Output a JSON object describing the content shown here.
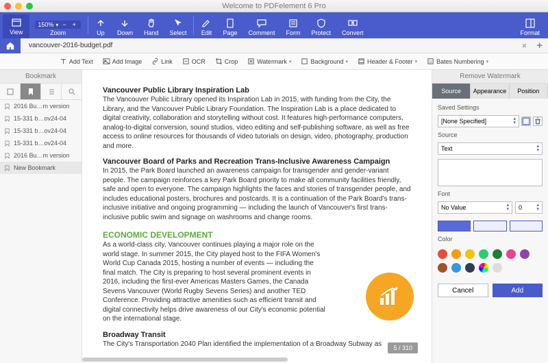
{
  "window": {
    "title": "Welcome to PDFelement 6 Pro"
  },
  "ribbon": {
    "view": "View",
    "zoom": "Zoom",
    "zoom_value": "150%",
    "up": "Up",
    "down": "Down",
    "hand": "Hand",
    "select": "Select",
    "edit": "Edit",
    "page": "Page",
    "comment": "Comment",
    "form": "Form",
    "protect": "Protect",
    "convert": "Convert",
    "format": "Format"
  },
  "tab": {
    "filename": "vancouver-2016-budget.pdf"
  },
  "toolbar2": {
    "add_text": "Add Text",
    "add_image": "Add Image",
    "link": "Link",
    "ocr": "OCR",
    "crop": "Crop",
    "watermark": "Watermark",
    "background": "Background",
    "header_footer": "Header & Footer",
    "bates": "Bates Numbering"
  },
  "sidebar": {
    "title": "Bookmark",
    "items": [
      "2016 Bu…m version",
      "15-331 b…ov24-04",
      "15-331 b…ov24-04",
      "15-331 b…ov24-04",
      "2016 Bu…m version",
      "New Bookmark"
    ]
  },
  "doc": {
    "h1": "Vancouver Public Library Inspiration Lab",
    "p1": "The Vancouver Public Library opened its Inspiration Lab in 2015, with funding from the City, the Library, and the Vancouver Public Library Foundation. The Inspiration Lab is a place dedicated to digital creativity, collaboration and storytelling without cost. It features high-performance computers, analog-to-digital conversion, sound studios, video editing and self-publishing software, as well as free access to online resources for thousands of video tutorials on design, video, photography, production and more.",
    "h2": "Vancouver Board of Parks and Recreation Trans-Inclusive Awareness Campaign",
    "p2": "In 2015, the Park Board launched an awareness campaign for transgender and gender-variant people. The campaign reinforces a key Park Board priority to make all community facilities friendly, safe and open to everyone. The campaign highlights the faces and stories of transgender people, and includes educational posters, brochures and postcards. It is a continuation of the Park Board's trans-inclusive initiative and ongoing programming — including the launch of Vancouver's first trans-inclusive public swim and signage on washrooms and change rooms.",
    "h3": "ECONOMIC DEVELOPMENT",
    "p3": "As a world-class city, Vancouver continues playing a major role on the world stage. In summer 2015, the City played host to the FIFA Women's World Cup Canada 2015, hosting a number of events — including the final match. The City is preparing to host several prominent events in 2016, including the first-ever Americas Masters Games, the Canada Sevens Vancouver (World Rugby Sevens Series) and another TED Conference. Providing attractive amenities such as efficient transit and digital connectivity helps drive awareness of our City's economic potential on the international stage.",
    "h4": "Broadway Transit",
    "p4": "The City's Transportation 2040 Plan identified the implementation of a Broadway Subway as",
    "page_indicator": "5 / 310"
  },
  "rpanel": {
    "title": "Remove Watermark",
    "tabs": {
      "source": "Source",
      "appearance": "Appearance",
      "position": "Position"
    },
    "saved_label": "Saved Settings",
    "saved_value": "[None Specified]",
    "source_label": "Source",
    "source_value": "Text",
    "font_label": "Font",
    "font_value": "No Value",
    "size_value": "0",
    "color_label": "Color",
    "colors": [
      "#e74c3c",
      "#f39c12",
      "#f1c40f",
      "#2ecc71",
      "#1e7e34",
      "#e84393",
      "#8e44ad",
      "#a0522d",
      "#3498db",
      "#2c3e50",
      "#95a5a6",
      "#bbbbbb"
    ],
    "cancel": "Cancel",
    "add": "Add"
  }
}
